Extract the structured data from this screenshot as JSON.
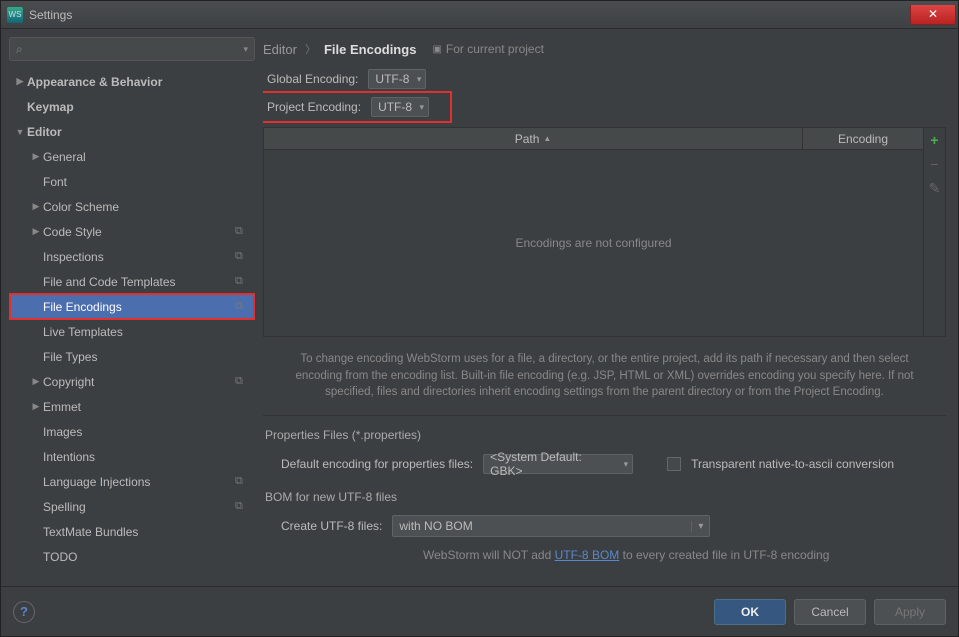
{
  "window": {
    "title": "Settings"
  },
  "breadcrumb": {
    "parent": "Editor",
    "current": "File Encodings",
    "for_project": "For current project"
  },
  "sidebar": {
    "items": [
      {
        "label": "Appearance & Behavior",
        "bold": true,
        "arrow": "right",
        "indent": 0
      },
      {
        "label": "Keymap",
        "bold": true,
        "arrow": "",
        "indent": 0
      },
      {
        "label": "Editor",
        "bold": true,
        "arrow": "down",
        "indent": 0
      },
      {
        "label": "General",
        "arrow": "right",
        "indent": 1
      },
      {
        "label": "Font",
        "arrow": "",
        "indent": 1
      },
      {
        "label": "Color Scheme",
        "arrow": "right",
        "indent": 1
      },
      {
        "label": "Code Style",
        "arrow": "right",
        "indent": 1,
        "copy": true
      },
      {
        "label": "Inspections",
        "arrow": "",
        "indent": 1,
        "copy": true
      },
      {
        "label": "File and Code Templates",
        "arrow": "",
        "indent": 1,
        "copy": true
      },
      {
        "label": "File Encodings",
        "arrow": "",
        "indent": 1,
        "copy": true,
        "selected": true
      },
      {
        "label": "Live Templates",
        "arrow": "",
        "indent": 1
      },
      {
        "label": "File Types",
        "arrow": "",
        "indent": 1
      },
      {
        "label": "Copyright",
        "arrow": "right",
        "indent": 1,
        "copy": true
      },
      {
        "label": "Emmet",
        "arrow": "right",
        "indent": 1
      },
      {
        "label": "Images",
        "arrow": "",
        "indent": 1
      },
      {
        "label": "Intentions",
        "arrow": "",
        "indent": 1
      },
      {
        "label": "Language Injections",
        "arrow": "",
        "indent": 1,
        "copy": true
      },
      {
        "label": "Spelling",
        "arrow": "",
        "indent": 1,
        "copy": true
      },
      {
        "label": "TextMate Bundles",
        "arrow": "",
        "indent": 1
      },
      {
        "label": "TODO",
        "arrow": "",
        "indent": 1
      }
    ]
  },
  "encodings": {
    "global_label": "Global Encoding:",
    "global_value": "UTF-8",
    "project_label": "Project Encoding:",
    "project_value": "UTF-8"
  },
  "table": {
    "path_header": "Path",
    "encoding_header": "Encoding",
    "empty_text": "Encodings are not configured"
  },
  "description": "To change encoding WebStorm uses for a file, a directory, or the entire project, add its path if necessary and then select encoding from the encoding list. Built-in file encoding (e.g. JSP, HTML or XML) overrides encoding you specify here. If not specified, files and directories inherit encoding settings from the parent directory or from the Project Encoding.",
  "properties": {
    "section": "Properties Files (*.properties)",
    "default_label": "Default encoding for properties files:",
    "default_value": "<System Default: GBK>",
    "transparent_label": "Transparent native-to-ascii conversion"
  },
  "bom": {
    "section": "BOM for new UTF-8 files",
    "create_label": "Create UTF-8 files:",
    "create_value": "with NO BOM",
    "note_prefix": "WebStorm will NOT add ",
    "note_link": "UTF-8 BOM",
    "note_suffix": " to every created file in UTF-8 encoding"
  },
  "buttons": {
    "ok": "OK",
    "cancel": "Cancel",
    "apply": "Apply"
  }
}
